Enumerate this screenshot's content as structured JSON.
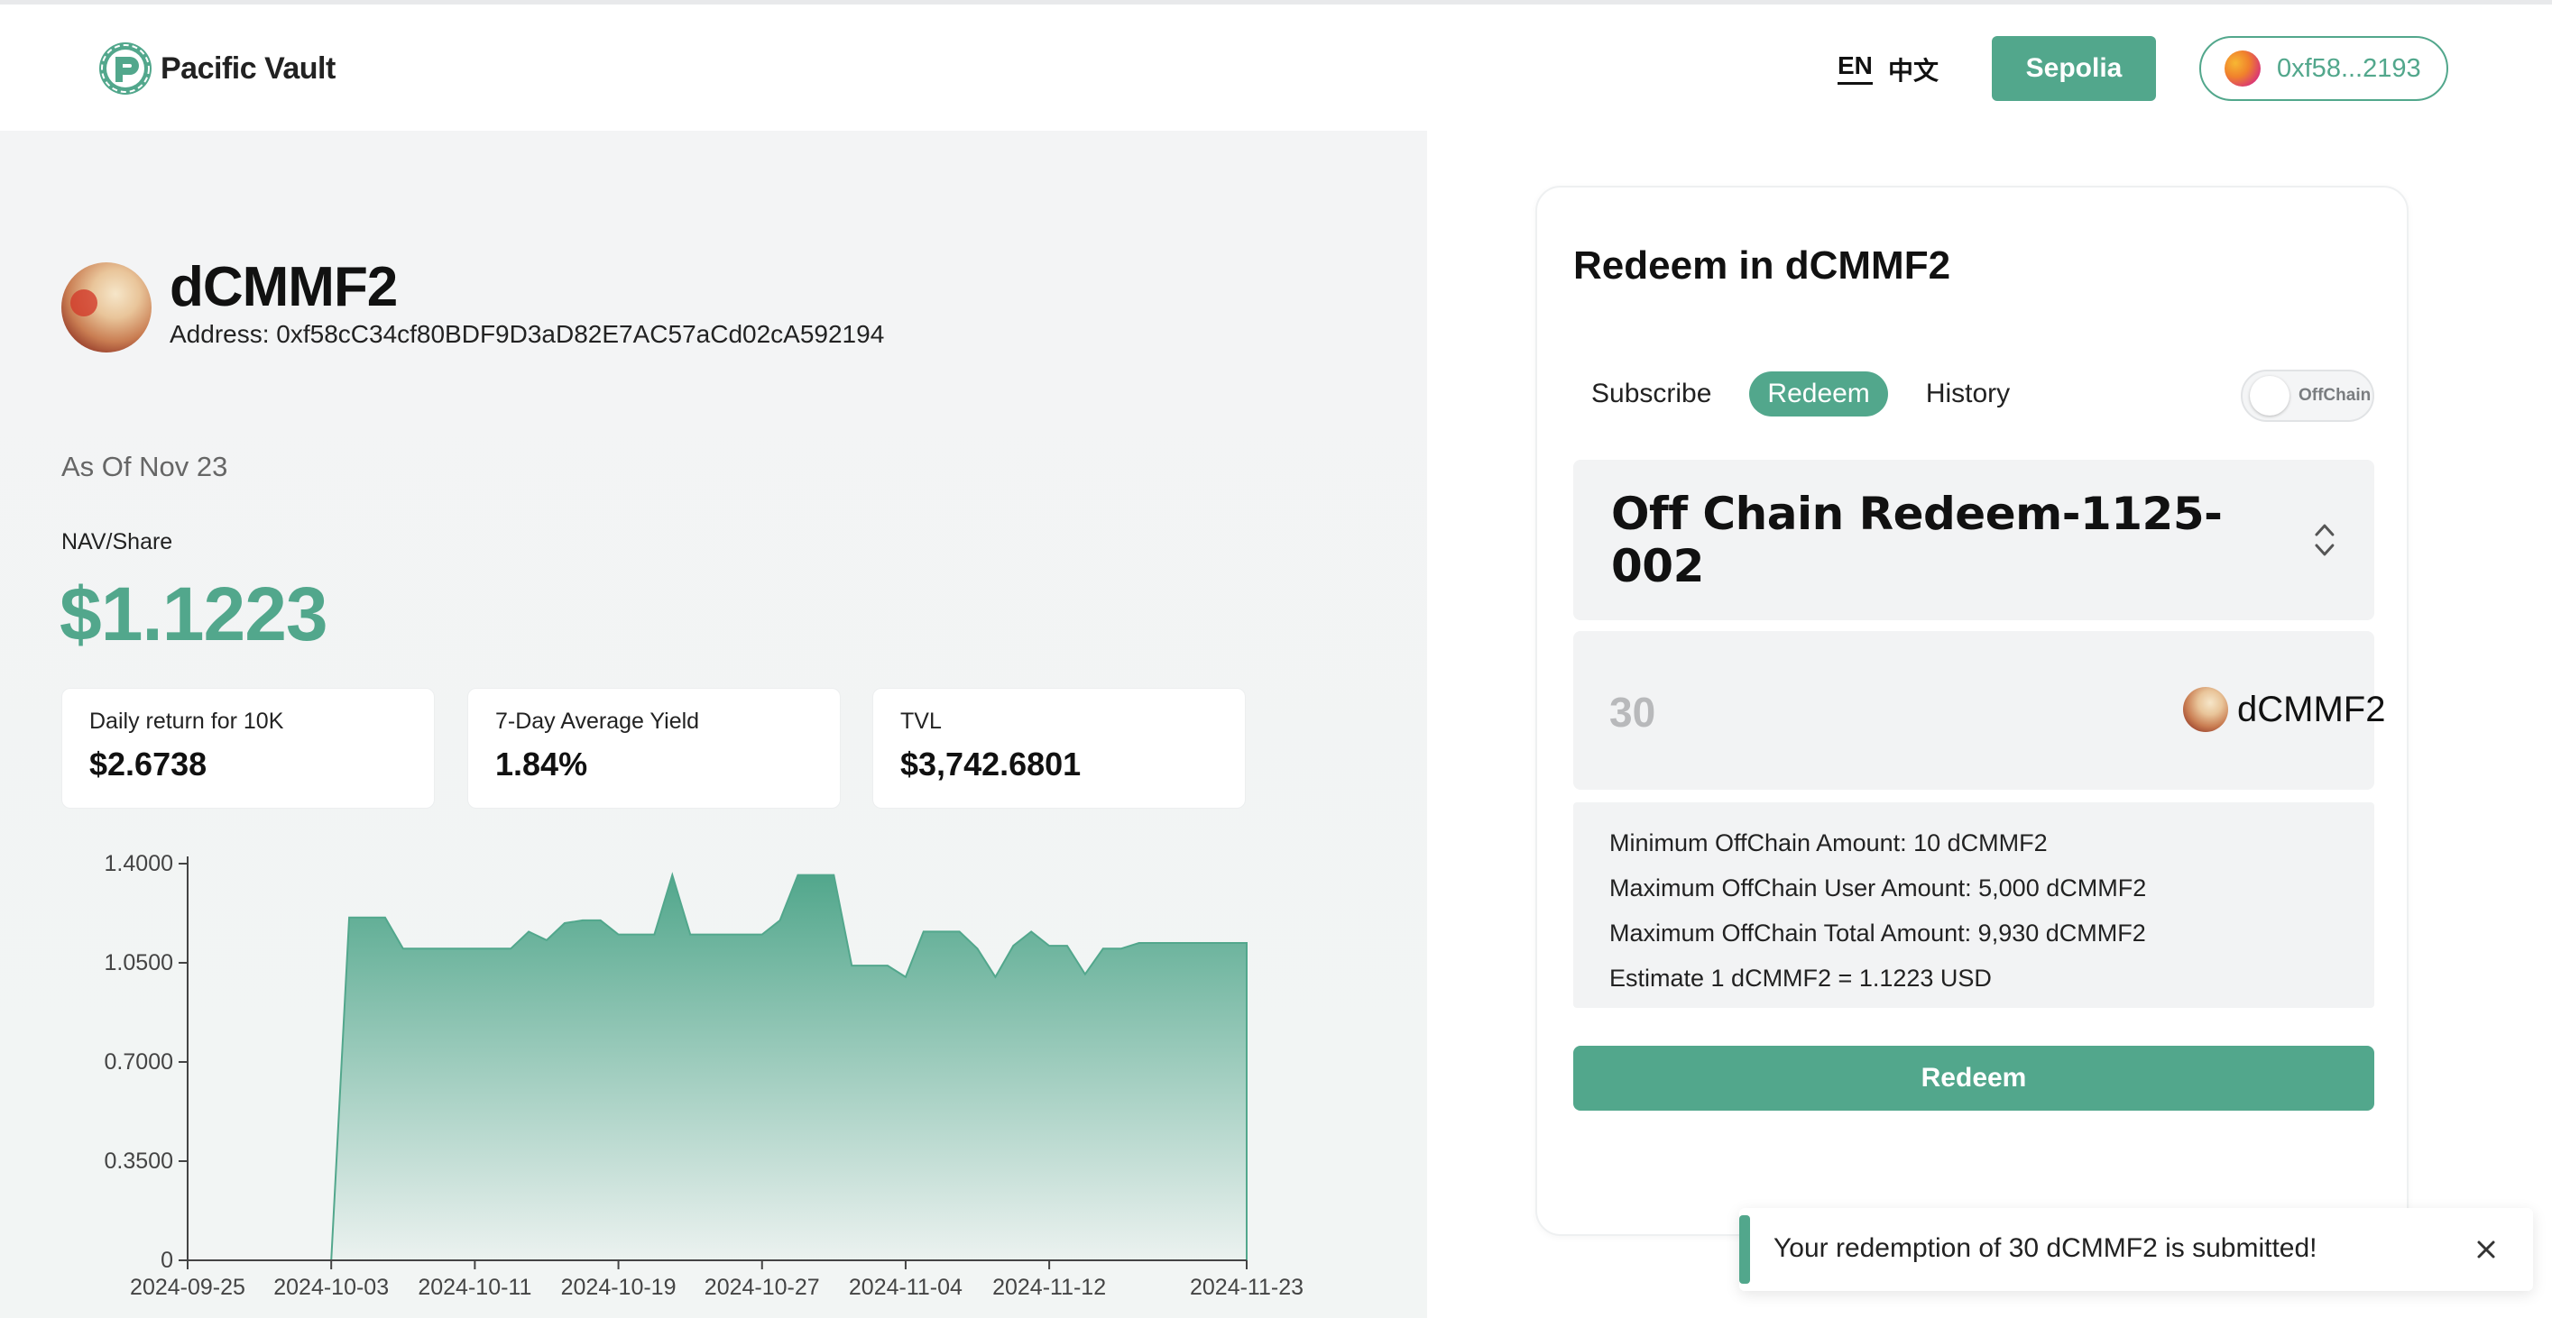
{
  "header": {
    "brand_name": "Pacific Vault",
    "lang_en": "EN",
    "lang_zh": "中文",
    "network_label": "Sepolia",
    "wallet_address": "0xf58...2193"
  },
  "fund": {
    "title": "dCMMF2",
    "address": "Address: 0xf58cC34cf80BDF9D3aD82E7AC57aCd02cA592194",
    "as_of": "As Of Nov 23",
    "nav_label": "NAV/Share",
    "nav_value": "$1.1223",
    "stats": [
      {
        "label": "Daily return for 10K",
        "value": "$2.6738"
      },
      {
        "label": "7-Day Average Yield",
        "value": "1.84%"
      },
      {
        "label": "TVL",
        "value": "$3,742.6801"
      }
    ]
  },
  "chart_data": {
    "type": "area",
    "x_ticks": [
      "2024-09-25",
      "2024-10-03",
      "2024-10-11",
      "2024-10-19",
      "2024-10-27",
      "2024-11-04",
      "2024-11-12",
      "2024-11-23"
    ],
    "y_ticks": [
      "0",
      "0.3500",
      "0.7000",
      "1.0500",
      "1.4000"
    ],
    "ylim": [
      0,
      1.4
    ],
    "series": [
      {
        "x": [
          "2024-09-25",
          "2024-10-03",
          "2024-10-04",
          "2024-10-05",
          "2024-10-06",
          "2024-10-07",
          "2024-10-08",
          "2024-10-09",
          "2024-10-10",
          "2024-10-11",
          "2024-10-12",
          "2024-10-13",
          "2024-10-14",
          "2024-10-15",
          "2024-10-16",
          "2024-10-17",
          "2024-10-18",
          "2024-10-19",
          "2024-10-20",
          "2024-10-21",
          "2024-10-22",
          "2024-10-23",
          "2024-10-24",
          "2024-10-25",
          "2024-10-26",
          "2024-10-27",
          "2024-10-28",
          "2024-10-29",
          "2024-10-30",
          "2024-10-31",
          "2024-11-01",
          "2024-11-02",
          "2024-11-03",
          "2024-11-04",
          "2024-11-05",
          "2024-11-06",
          "2024-11-07",
          "2024-11-08",
          "2024-11-09",
          "2024-11-10",
          "2024-11-11",
          "2024-11-12",
          "2024-11-13",
          "2024-11-14",
          "2024-11-15",
          "2024-11-16",
          "2024-11-17",
          "2024-11-18",
          "2024-11-19",
          "2024-11-20",
          "2024-11-21",
          "2024-11-22",
          "2024-11-23"
        ],
        "values": [
          0,
          0,
          1.21,
          1.21,
          1.21,
          1.1,
          1.1,
          1.1,
          1.1,
          1.1,
          1.1,
          1.1,
          1.16,
          1.13,
          1.19,
          1.2,
          1.2,
          1.15,
          1.15,
          1.15,
          1.36,
          1.15,
          1.15,
          1.15,
          1.15,
          1.15,
          1.2,
          1.36,
          1.36,
          1.36,
          1.04,
          1.04,
          1.04,
          1.0,
          1.16,
          1.16,
          1.16,
          1.1,
          1.0,
          1.11,
          1.16,
          1.11,
          1.11,
          1.01,
          1.1,
          1.1,
          1.12,
          1.12,
          1.12,
          1.12,
          1.12,
          1.12,
          1.12
        ]
      }
    ],
    "fill_color": "#52a78c"
  },
  "redeem_card": {
    "title": "Redeem in dCMMF2",
    "tabs": [
      "Subscribe",
      "Redeem",
      "History"
    ],
    "active_tab": "Redeem",
    "toggle_label": "OffChain",
    "selected_option": "Off Chain Redeem-1125-002",
    "amount_placeholder": "30",
    "token_name": "dCMMF2",
    "info_lines": [
      "Minimum OffChain Amount: 10 dCMMF2",
      "Maximum OffChain User Amount: 5,000 dCMMF2",
      "Maximum OffChain Total Amount: 9,930 dCMMF2",
      "Estimate 1 dCMMF2 = 1.1223 USD"
    ],
    "redeem_button": "Redeem"
  },
  "toast": {
    "message": "Your redemption of 30 dCMMF2 is submitted!"
  },
  "colors": {
    "accent": "#52a78c"
  }
}
